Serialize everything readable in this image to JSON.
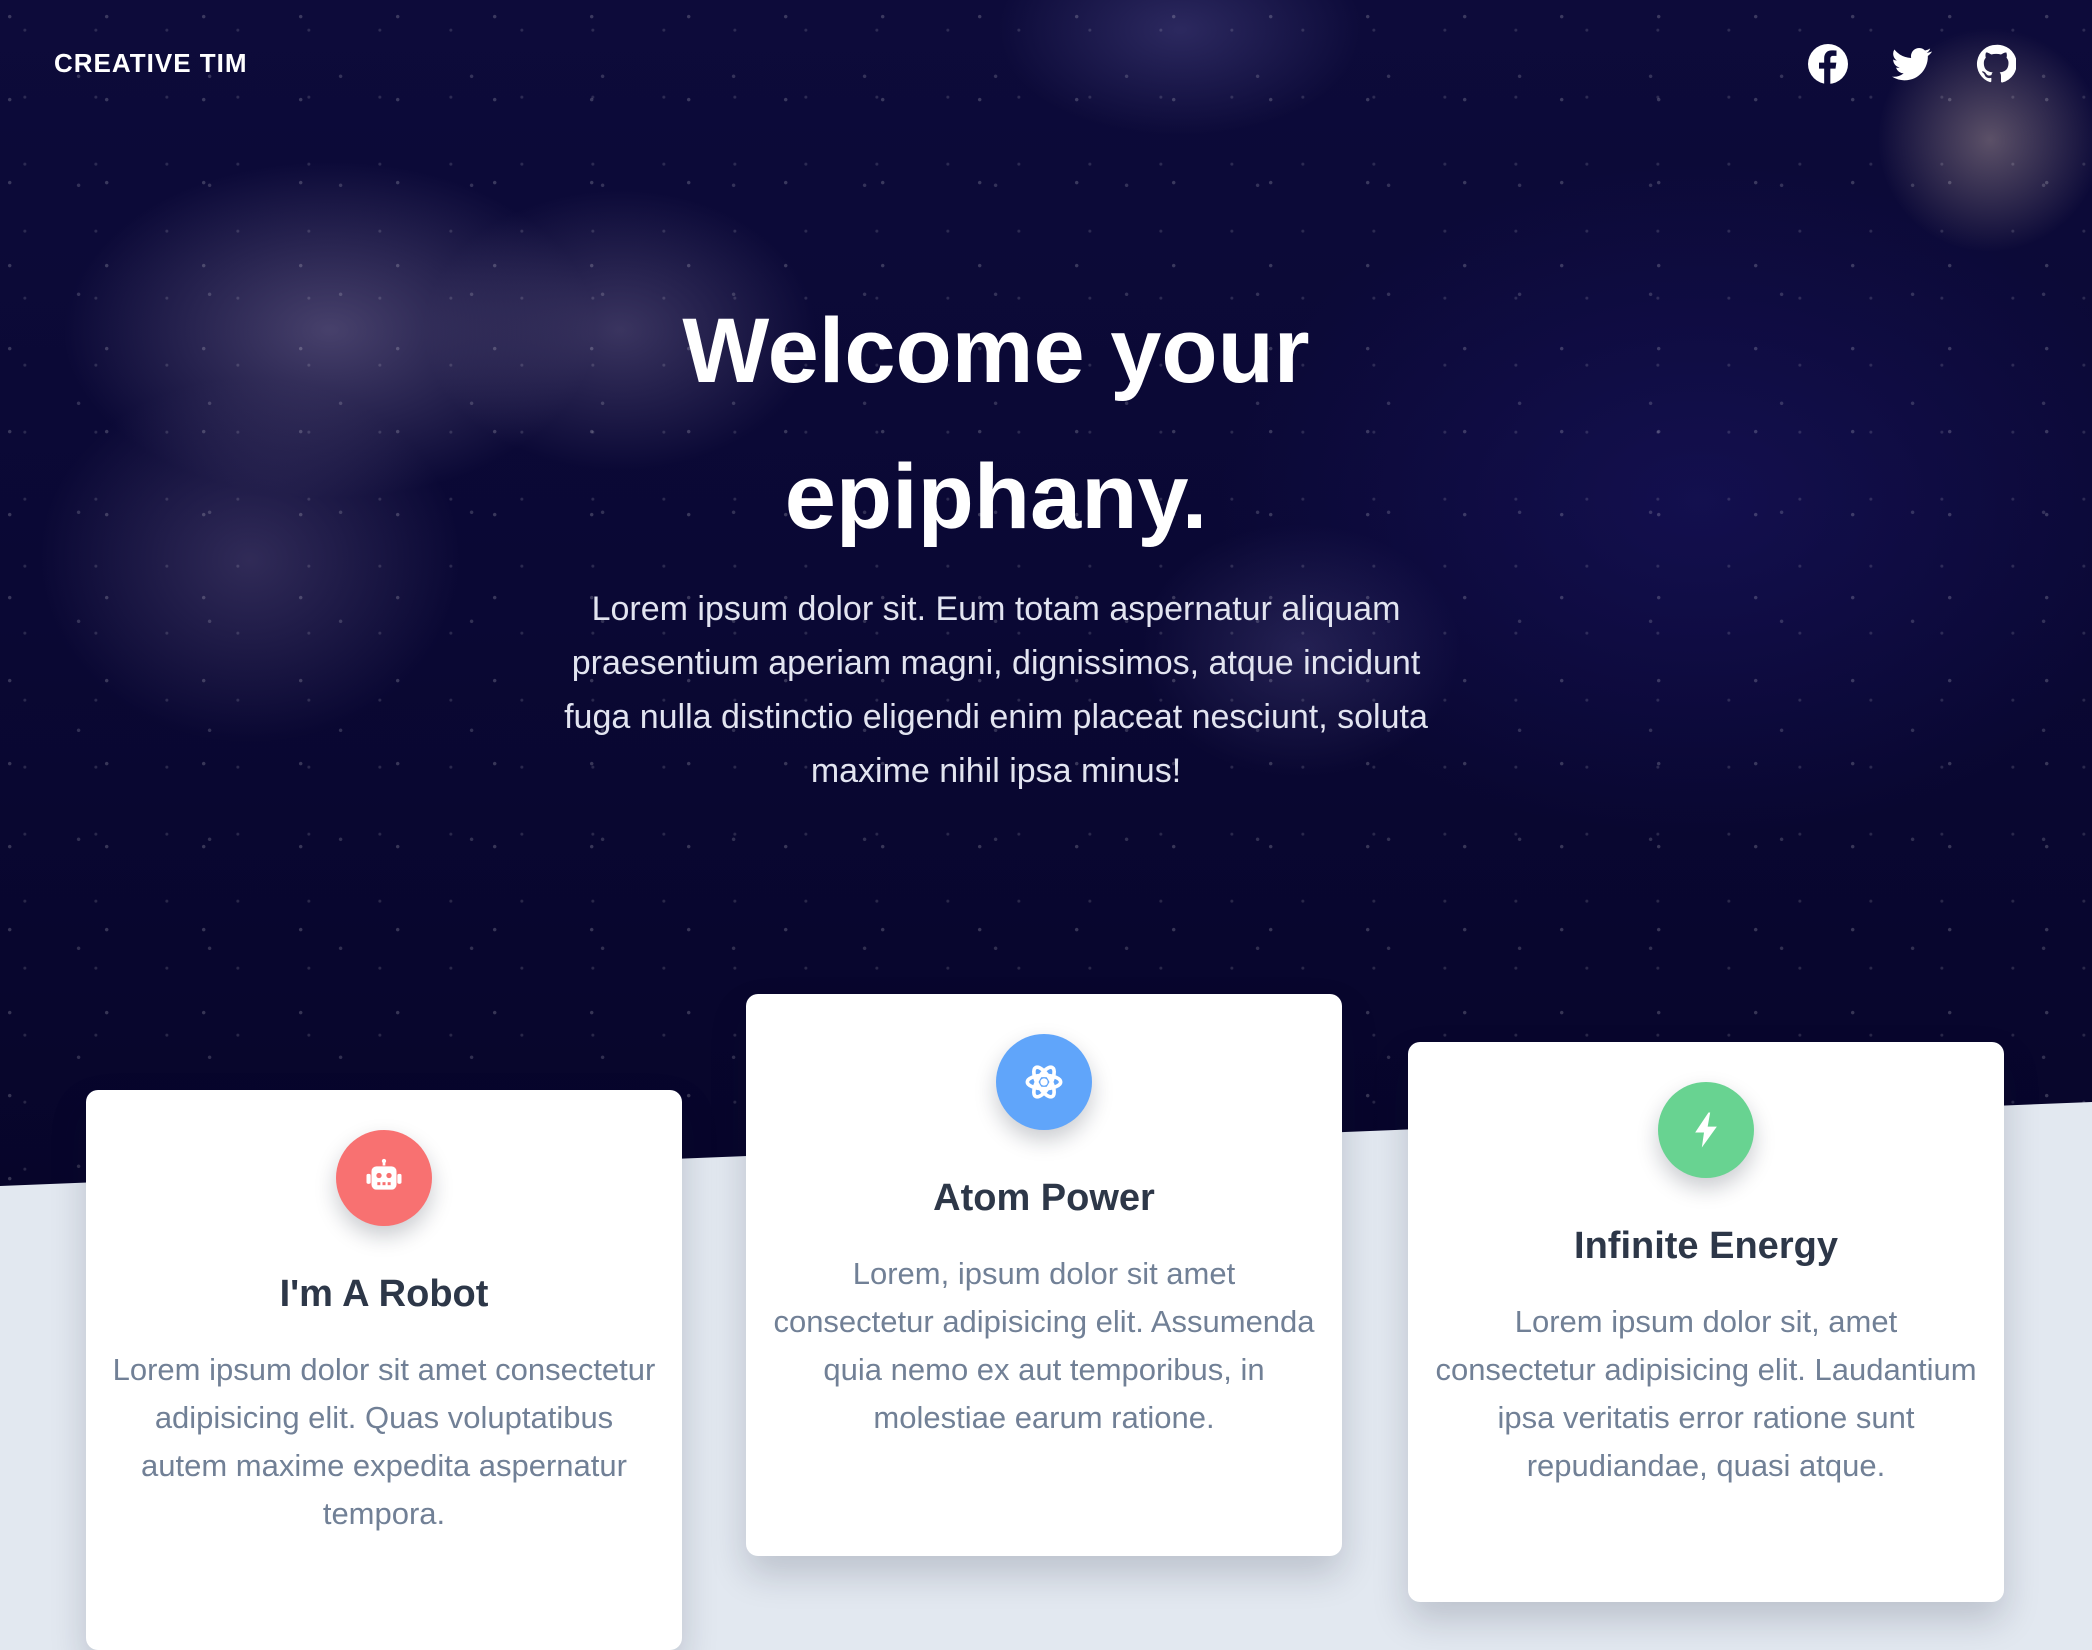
{
  "navbar": {
    "brand": "CREATIVE TIM",
    "social": [
      {
        "icon": "facebook-icon"
      },
      {
        "icon": "twitter-icon"
      },
      {
        "icon": "github-icon"
      }
    ]
  },
  "hero": {
    "title": "Welcome your epiphany.",
    "description": "Lorem ipsum dolor sit. Eum totam aspernatur aliquam praesentium aperiam magni, dignissimos, atque incidunt fuga nulla distinctio eligendi enim placeat nesciunt, soluta maxime nihil ipsa minus!"
  },
  "features": [
    {
      "icon": "robot-icon",
      "color": "#f87171",
      "title": "I'm A Robot",
      "text": "Lorem ipsum dolor sit amet consectetur adipisicing elit. Quas voluptatibus autem maxime expedita aspernatur tempora."
    },
    {
      "icon": "atom-icon",
      "color": "#60a5fa",
      "title": "Atom Power",
      "text": "Lorem, ipsum dolor sit amet consectetur adipisicing elit. Assumenda quia nemo ex aut temporibus, in molestiae earum ratione."
    },
    {
      "icon": "lightning-icon",
      "color": "#68d391",
      "title": "Infinite Energy",
      "text": "Lorem ipsum dolor sit, amet consectetur adipisicing elit. Laudantium ipsa veritatis error ratione sunt repudiandae, quasi atque."
    }
  ]
}
